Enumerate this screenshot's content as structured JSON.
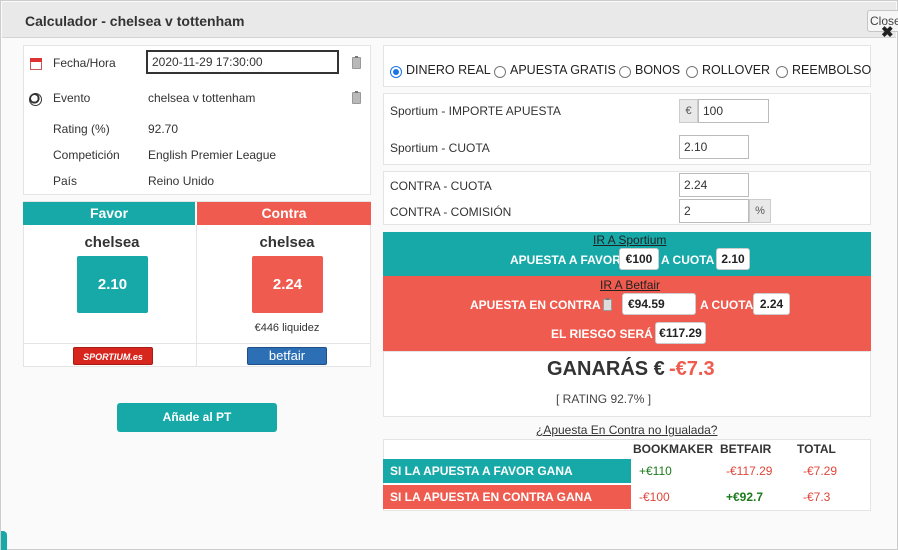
{
  "dialog": {
    "title": "Calculador - chelsea v tottenham",
    "close_label": "Close",
    "close_x": "✖"
  },
  "event": {
    "date_label": "Fecha/Hora",
    "date_value": "2020-11-29 17:30:00",
    "event_label": "Evento",
    "event_value": "chelsea v tottenham",
    "rating_label": "Rating (%)",
    "rating_value": "92.70",
    "competition_label": "Competición",
    "competition_value": "English Premier League",
    "country_label": "País",
    "country_value": "Reino Unido"
  },
  "favor": {
    "header": "Favor",
    "team": "chelsea",
    "odd": "2.10",
    "bookmaker_logo": "SPORTIUM.es"
  },
  "contra": {
    "header": "Contra",
    "team": "chelsea",
    "odd": "2.24",
    "liquidity": "€446 liquidez",
    "exchange_logo": "betfair"
  },
  "add_button": "Añade al PT",
  "bet_types": {
    "options": [
      "DINERO REAL",
      "APUESTA GRATIS",
      "BONOS",
      "ROLLOVER",
      "REEMBOLSO"
    ],
    "selected": "DINERO REAL"
  },
  "stake": {
    "amount_label": "Sportium - IMPORTE APUESTA",
    "currency": "€",
    "amount_value": "100",
    "odd_label": "Sportium - CUOTA",
    "odd_value": "2.10"
  },
  "lay": {
    "odd_label": "CONTRA - CUOTA",
    "odd_value": "2.24",
    "commission_label": "CONTRA - COMISIÓN",
    "commission_value": "2",
    "percent": "%"
  },
  "instructions": {
    "go_sportium": "IR A Sportium",
    "back_text": "APUESTA A FAVOR",
    "back_amount": "€100",
    "back_at": "A CUOTA",
    "back_odd": "2.10",
    "go_betfair": "IR A Betfair",
    "lay_text": "APUESTA EN CONTRA",
    "lay_amount": "€94.59",
    "lay_at": "A CUOTA",
    "lay_odd": "2.24",
    "risk_text": "EL RIESGO SERÁ",
    "risk_amount": "€117.29"
  },
  "result": {
    "win_label": "GANARÁS €",
    "win_value": "-€7.3",
    "rating_text": "[ RATING 92.7% ]",
    "unmatched_link": "¿Apuesta En Contra no Igualada?"
  },
  "table": {
    "headers": [
      "BOOKMAKER",
      "BETFAIR",
      "TOTAL"
    ],
    "rows": [
      {
        "label": "SI LA APUESTA A FAVOR GANA",
        "bookmaker": "+€110",
        "betfair": "-€117.29",
        "total": "-€7.29"
      },
      {
        "label": "SI LA APUESTA EN CONTRA GANA",
        "bookmaker": "-€100",
        "betfair": "+€92.7",
        "total": "-€7.3"
      }
    ]
  },
  "colors": {
    "accent": "#17a8a8",
    "contra": "#ef5b4e",
    "positive": "#1b7a1b",
    "negative": "#e0463b"
  }
}
